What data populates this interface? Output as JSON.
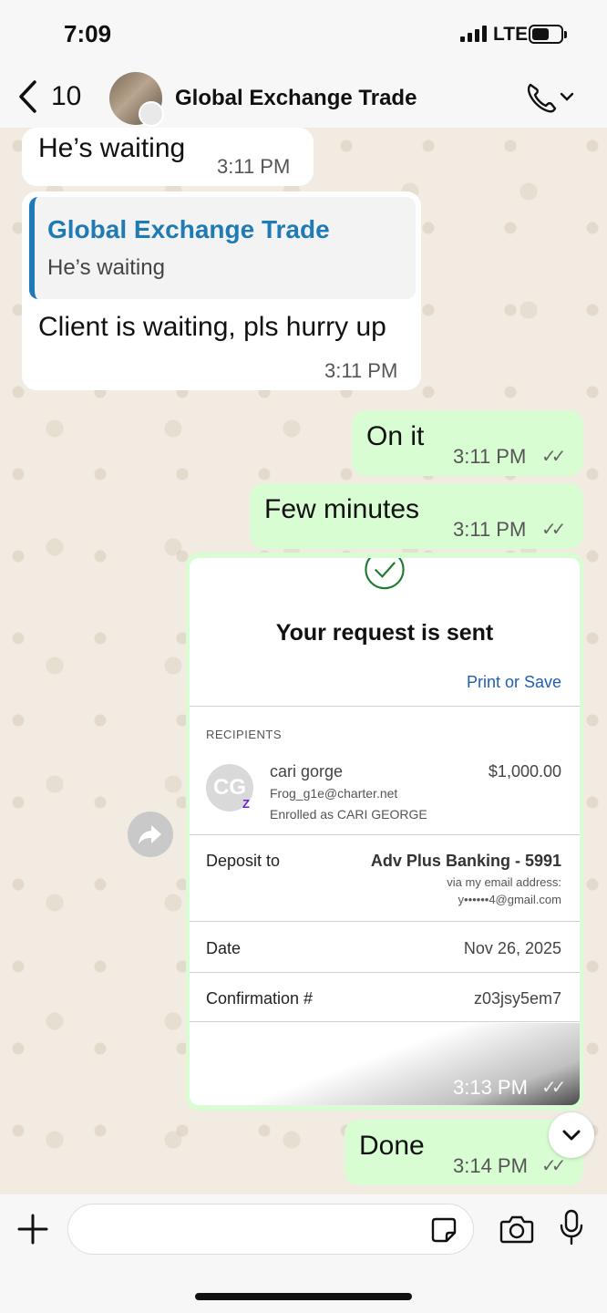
{
  "status": {
    "time": "7:09",
    "network": "LTE"
  },
  "header": {
    "back_count": "10",
    "contact_name": "Global Exchange Trade"
  },
  "messages": [
    {
      "text": "He’s waiting",
      "time": "3:11 PM"
    },
    {
      "quote_name": "Global Exchange Trade",
      "quote_text": "He’s waiting",
      "text": "Client is waiting, pls hurry up",
      "time": "3:11 PM"
    },
    {
      "text": "On it",
      "time": "3:11 PM",
      "ticks": "✓✓"
    },
    {
      "text": "Few minutes",
      "time": "3:11 PM",
      "ticks": "✓✓"
    },
    {
      "time": "3:13 PM",
      "ticks": "✓✓"
    },
    {
      "text": "Done",
      "time": "3:14 PM",
      "ticks": "✓✓"
    }
  ],
  "receipt": {
    "title": "Your request is sent",
    "print_label": "Print or Save",
    "recipients_label": "RECIPIENTS",
    "avatar_initials": "CG",
    "zelle_mark": "Z",
    "recipient_name": "cari gorge",
    "recipient_email": "Frog_g1e@charter.net",
    "enrolled": "Enrolled as CARI GEORGE",
    "amount": "$1,000.00",
    "deposit_label": "Deposit to",
    "deposit_account": "Adv Plus Banking - 5991",
    "deposit_via": "via my email address:",
    "deposit_email": "y••••••4@gmail.com",
    "date_label": "Date",
    "date_value": "Nov 26, 2025",
    "confirmation_label": "Confirmation #",
    "confirmation_value": "z03jsy5em7"
  },
  "icons": [
    "chevron-left-icon",
    "phone-icon",
    "chevron-down-icon",
    "forward-icon",
    "plus-icon",
    "sticker-icon",
    "camera-icon",
    "mic-icon",
    "check-circle-icon"
  ]
}
